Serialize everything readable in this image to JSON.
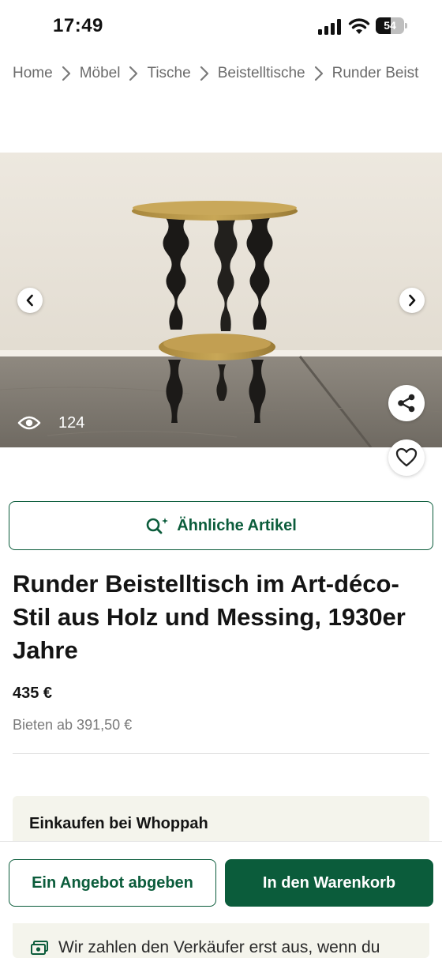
{
  "status_bar": {
    "time": "17:49",
    "battery": "54",
    "battery_level": 0.54
  },
  "breadcrumb": [
    "Home",
    "Möbel",
    "Tische",
    "Beistelltische",
    "Runder Beist"
  ],
  "gallery": {
    "view_count": "124",
    "icons": [
      "chevron-left-icon",
      "chevron-right-icon",
      "eye-icon",
      "share-icon",
      "heart-icon"
    ]
  },
  "similar_button": {
    "label": "Ähnliche Artikel",
    "icon": "search-sparkle-icon"
  },
  "product": {
    "title": "Runder Beistelltisch im Art-déco-Stil aus Holz und Messing, 1930er Jahre",
    "price": "435 €",
    "bid_from": "Bieten ab 391,50 €"
  },
  "shop_info": {
    "heading": "Einkaufen bei Whoppah",
    "payout_note": "Wir zahlen den Verkäufer erst aus, wenn du"
  },
  "actions": {
    "offer_label": "Ein Angebot abgeben",
    "cart_label": "In den Warenkorb"
  },
  "colors": {
    "brand_green": "#0b5c3b",
    "card_bg": "#f4f4ec",
    "muted_text": "#6b6b6b"
  }
}
